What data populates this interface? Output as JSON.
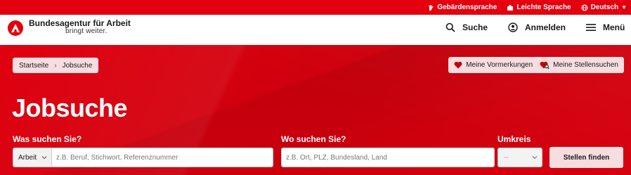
{
  "topbar": {
    "items": [
      {
        "label": "Gebärdensprache",
        "icon": "sign-language-icon"
      },
      {
        "label": "Leichte Sprache",
        "icon": "easy-language-icon"
      },
      {
        "label": "Deutsch",
        "icon": "globe-icon"
      }
    ]
  },
  "header": {
    "logo_name": "Bundesagentur für Arbeit",
    "logo_tagline": "bringt weiter.",
    "search_label": "Suche",
    "login_label": "Anmelden",
    "menu_label": "Menü"
  },
  "breadcrumb": {
    "items": [
      "Startseite",
      "Jobsuche"
    ],
    "separator": "›"
  },
  "merk": {
    "vormerkungen": "Meine Vormerkungen",
    "stellensuchen": "Meine Stellensuchen"
  },
  "main": {
    "title": "Jobsuche",
    "what_label": "Was suchen Sie?",
    "where_label": "Wo suchen Sie?",
    "radius_label": "Umkreis",
    "type_select_value": "Arbeit",
    "what_placeholder": "z.B. Beruf, Stichwort, Referenznummer",
    "where_placeholder": "z.B. Ort, PLZ, Bundesland, Land",
    "radius_value": "--",
    "submit_label": "Stellen finden"
  },
  "colors": {
    "brand_red": "#e3000f",
    "hero_red": "#d2000d",
    "pale_pink": "#f6dde0"
  }
}
